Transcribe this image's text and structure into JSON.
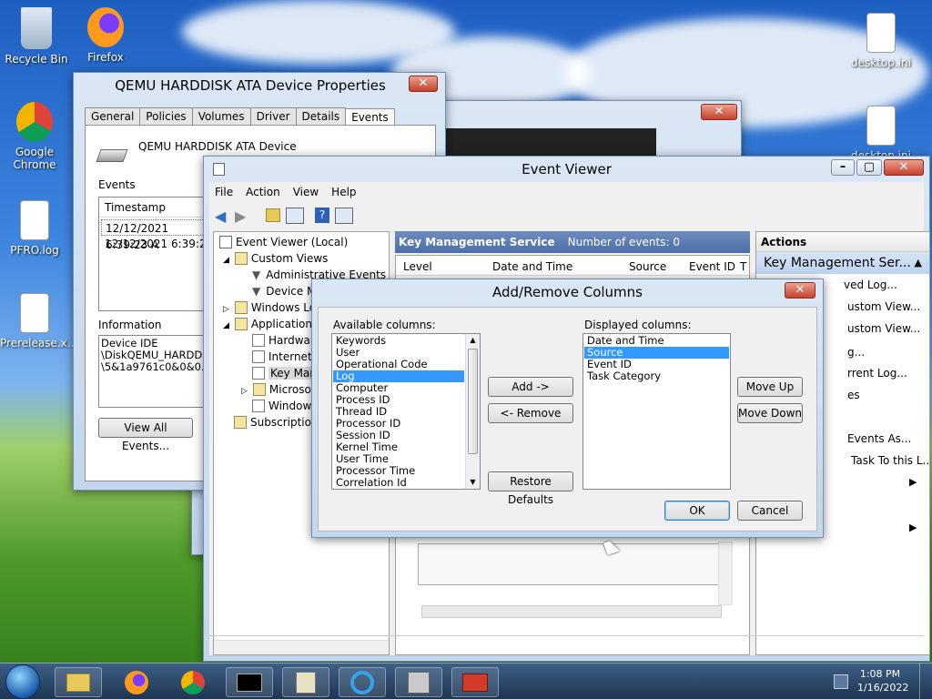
{
  "desktop": {
    "icons": [
      {
        "label": "Recycle Bin"
      },
      {
        "label": "Firefox"
      },
      {
        "label": "Google Chrome"
      },
      {
        "label": "PFRO.log"
      },
      {
        "label": "Prerelease.x..."
      },
      {
        "label": "desktop.ini"
      },
      {
        "label": "desktop.ini"
      }
    ]
  },
  "device_props": {
    "title": "QEMU HARDDISK ATA Device Properties",
    "tabs": [
      "General",
      "Policies",
      "Volumes",
      "Driver",
      "Details",
      "Events"
    ],
    "device_name": "QEMU HARDDISK ATA Device",
    "events_label": "Events",
    "timestamp_header": "Timestamp",
    "rows": [
      "12/12/2021 6:39:23 A",
      "12/12/2021 6:39:23 A"
    ],
    "info_label": "Information",
    "info_lines": [
      "Device IDE",
      "\\DiskQEMU_HARDDIS",
      "\\5&1a9761c0&0&0.0.0 w"
    ],
    "view_all_button": "View All Events..."
  },
  "event_viewer": {
    "title": "Event Viewer",
    "menu": [
      "File",
      "Action",
      "View",
      "Help"
    ],
    "tree": [
      "Event Viewer (Local)",
      "Custom Views",
      "Administrative Events",
      "Device M",
      "Windows Lo",
      "Applications",
      "Hardwar",
      "Internet",
      "Key Man",
      "Microsof",
      "Window",
      "Subscription"
    ],
    "pane_title": "Key Management Service",
    "event_count": "Number of events: 0",
    "columns": [
      "Level",
      "Date and Time",
      "Source",
      "Event ID",
      "T"
    ],
    "actions_header": "Actions",
    "actions_selected": "Key Management Ser...",
    "actions": [
      "ved Log...",
      "ustom View...",
      "ustom View...",
      "g...",
      "rrent Log...",
      "es",
      "Events As...",
      "Task To this L..."
    ]
  },
  "dialog": {
    "title": "Add/Remove Columns",
    "available_label": "Available columns:",
    "available": [
      "Keywords",
      "User",
      "Operational Code",
      "Log",
      "Computer",
      "Process ID",
      "Thread ID",
      "Processor ID",
      "Session ID",
      "Kernel Time",
      "User Time",
      "Processor Time",
      "Correlation Id"
    ],
    "available_selected": 3,
    "displayed_label": "Displayed columns:",
    "displayed": [
      "Date and Time",
      "Source",
      "Event ID",
      "Task Category"
    ],
    "displayed_selected": 1,
    "add_button": "Add ->",
    "remove_button": "<- Remove",
    "restore_button": "Restore Defaults",
    "move_up_button": "Move Up",
    "move_down_button": "Move Down",
    "ok_button": "OK",
    "cancel_button": "Cancel"
  },
  "taskbar": {
    "time": "1:08 PM",
    "date": "1/16/2022"
  }
}
